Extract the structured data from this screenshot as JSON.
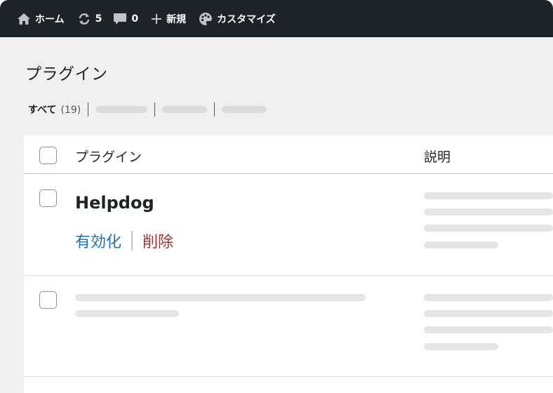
{
  "adminbar": {
    "home_label": "ホーム",
    "updates_count": "5",
    "comments_count": "0",
    "new_label": "新規",
    "customize_label": "カスタマイズ"
  },
  "page": {
    "title": "プラグイン"
  },
  "filters": {
    "all_label": "すべて",
    "all_count": "(19)"
  },
  "table": {
    "columns": [
      "プラグイン",
      "説明"
    ],
    "rows": [
      {
        "name": "Helpdog",
        "actions": {
          "activate": "有効化",
          "delete": "削除"
        }
      }
    ]
  },
  "colors": {
    "adminbar_bg": "#1d2327",
    "link_blue": "#2271b1",
    "delete_red": "#b32d2e"
  }
}
